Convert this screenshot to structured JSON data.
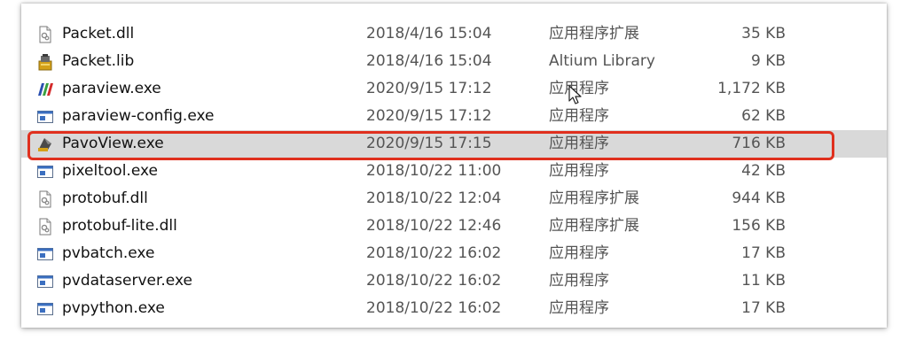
{
  "files": [
    {
      "name": "Packet.dll",
      "date": "2018/4/16 15:04",
      "type": "应用程序扩展",
      "size": "35 KB",
      "icon": "dll-file-icon"
    },
    {
      "name": "Packet.lib",
      "date": "2018/4/16 15:04",
      "type": "Altium Library",
      "size": "9 KB",
      "icon": "altium-library-icon"
    },
    {
      "name": "paraview.exe",
      "date": "2020/9/15 17:12",
      "type": "应用程序",
      "size": "1,172 KB",
      "icon": "paraview-icon"
    },
    {
      "name": "paraview-config.exe",
      "date": "2020/9/15 17:12",
      "type": "应用程序",
      "size": "62 KB",
      "icon": "exe-icon"
    },
    {
      "name": "PavoView.exe",
      "date": "2020/9/15 17:15",
      "type": "应用程序",
      "size": "716 KB",
      "icon": "pavoview-icon"
    },
    {
      "name": "pixeltool.exe",
      "date": "2018/10/22 11:00",
      "type": "应用程序",
      "size": "42 KB",
      "icon": "exe-icon"
    },
    {
      "name": "protobuf.dll",
      "date": "2018/10/22 12:04",
      "type": "应用程序扩展",
      "size": "944 KB",
      "icon": "dll-file-icon"
    },
    {
      "name": "protobuf-lite.dll",
      "date": "2018/10/22 12:46",
      "type": "应用程序扩展",
      "size": "156 KB",
      "icon": "dll-file-icon"
    },
    {
      "name": "pvbatch.exe",
      "date": "2018/10/22 16:02",
      "type": "应用程序",
      "size": "17 KB",
      "icon": "exe-icon"
    },
    {
      "name": "pvdataserver.exe",
      "date": "2018/10/22 16:02",
      "type": "应用程序",
      "size": "11 KB",
      "icon": "exe-icon"
    },
    {
      "name": "pvpython.exe",
      "date": "2018/10/22 16:02",
      "type": "应用程序",
      "size": "17 KB",
      "icon": "exe-icon"
    }
  ],
  "selected_row": "PavoView.exe",
  "colors": {
    "highlight": "#e0301e",
    "selected_bg": "#d9d9d9"
  }
}
